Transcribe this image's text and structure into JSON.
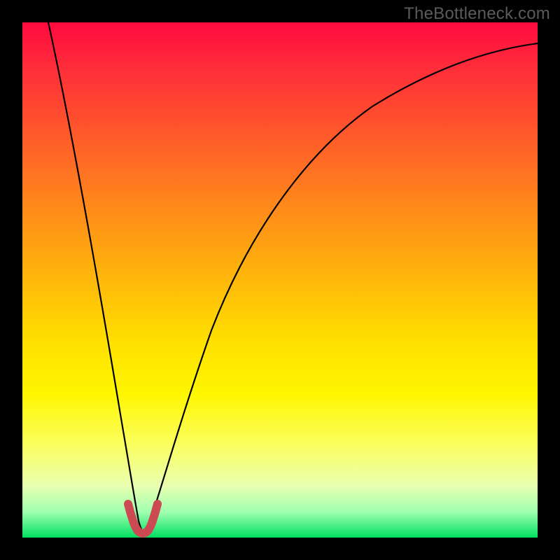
{
  "watermark": "TheBottleneck.com",
  "chart_data": {
    "type": "line",
    "title": "",
    "xlabel": "",
    "ylabel": "",
    "xlim": [
      0,
      100
    ],
    "ylim": [
      0,
      100
    ],
    "grid": false,
    "series": [
      {
        "name": "bottleneck-curve",
        "x": [
          5,
          10,
          14,
          18,
          20,
          22,
          23,
          25,
          27,
          30,
          35,
          40,
          45,
          50,
          55,
          60,
          65,
          70,
          75,
          80,
          85,
          90,
          95,
          100
        ],
        "values": [
          100,
          78,
          56,
          30,
          14,
          3,
          0,
          3,
          14,
          30,
          48,
          60,
          68,
          74,
          78,
          82,
          85,
          87,
          89,
          90.5,
          92,
          93,
          94,
          95
        ]
      },
      {
        "name": "fit-marker",
        "x": [
          20.5,
          21.5,
          22.5,
          23.5,
          24.5,
          25.5
        ],
        "values": [
          6,
          2.5,
          0.5,
          0.5,
          2.5,
          6
        ]
      }
    ],
    "annotations": [],
    "legend": false,
    "balance_point_x": 23
  }
}
